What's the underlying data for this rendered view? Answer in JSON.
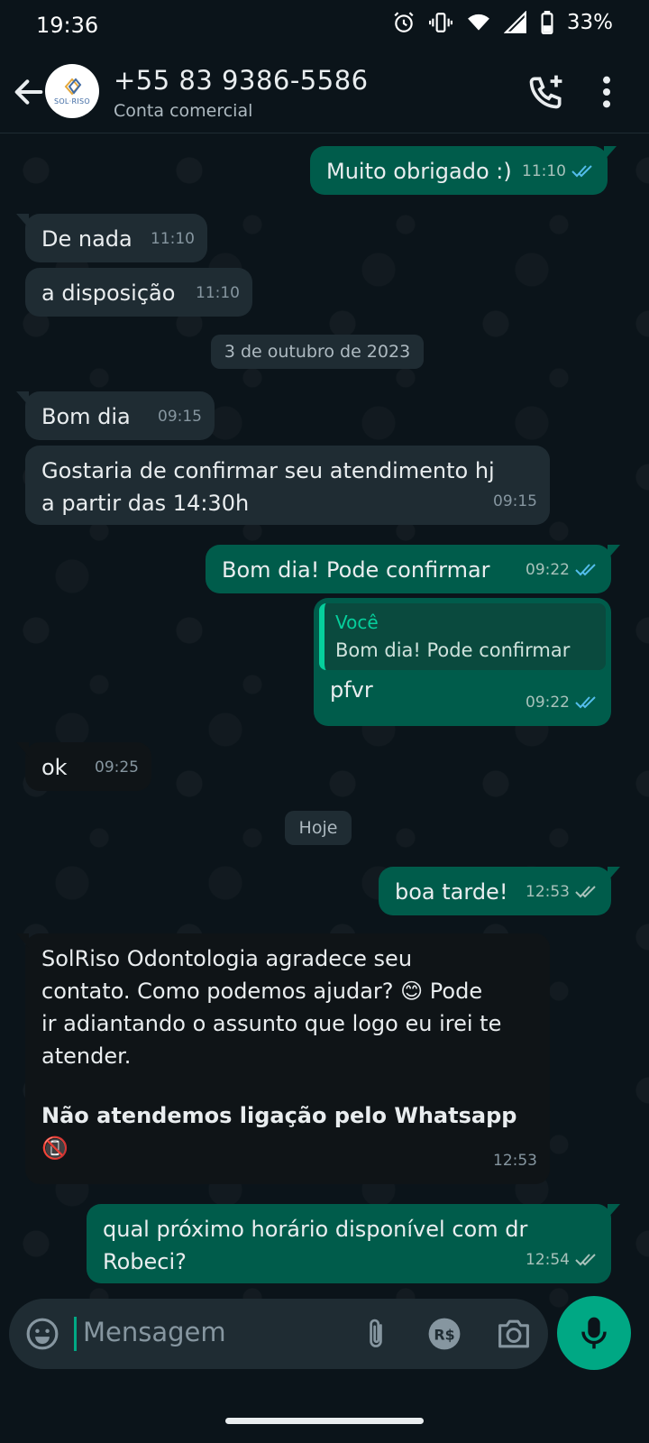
{
  "status_bar": {
    "time": "19:36",
    "battery_pct": "33%",
    "icons": [
      "alarm-icon",
      "vibrate-icon",
      "wifi-icon",
      "signal-icon",
      "battery-icon"
    ]
  },
  "header": {
    "contact_name": "+55 83 9386-5586",
    "subtitle": "Conta comercial",
    "avatar_logo_text": "SOL·RISO"
  },
  "messages": [
    {
      "dir": "out",
      "text": "Muito obrigado :)",
      "time": "11:10",
      "ticks": "read"
    },
    {
      "dir": "in",
      "text": "De nada",
      "time": "11:10"
    },
    {
      "dir": "in",
      "text": "a disposição",
      "time": "11:10"
    },
    {
      "dir": "date",
      "text": "3 de outubro de 2023"
    },
    {
      "dir": "in",
      "text": "Bom dia",
      "time": "09:15"
    },
    {
      "dir": "in",
      "text_lines": [
        "Gostaria de confirmar seu atendimento hj",
        "a partir das 14:30h"
      ],
      "time": "09:15"
    },
    {
      "dir": "out",
      "text": "Bom dia! Pode confirmar",
      "time": "09:22",
      "ticks": "read"
    },
    {
      "dir": "out",
      "quote_author": "Você",
      "quote_text": "Bom dia! Pode confirmar",
      "text": "pfvr",
      "time": "09:22",
      "ticks": "read"
    },
    {
      "dir": "in",
      "text": "ok",
      "time": "09:25"
    },
    {
      "dir": "date",
      "text": "Hoje"
    },
    {
      "dir": "out",
      "text": "boa tarde!",
      "time": "12:53",
      "ticks": "delivered"
    },
    {
      "dir": "in",
      "text_lines": [
        "SolRiso Odontologia agradece seu",
        "contato. Como podemos ajudar? 😊 Pode",
        "ir adiantando o assunto que logo eu irei te",
        "atender."
      ],
      "bold_lines": [
        "Não atendemos ligação pelo Whatsapp",
        "📵"
      ],
      "time": "12:53"
    },
    {
      "dir": "out",
      "text_lines": [
        "qual próximo horário disponível com dr",
        "Robeci?"
      ],
      "time": "12:54",
      "ticks": "delivered"
    }
  ],
  "input": {
    "placeholder": "Mensagem"
  },
  "colors": {
    "background": "#0b141a",
    "incoming_bubble": "#1f2c33",
    "outgoing_bubble": "#005c4b",
    "accent": "#00a884",
    "read_ticks": "#53bdeb"
  }
}
